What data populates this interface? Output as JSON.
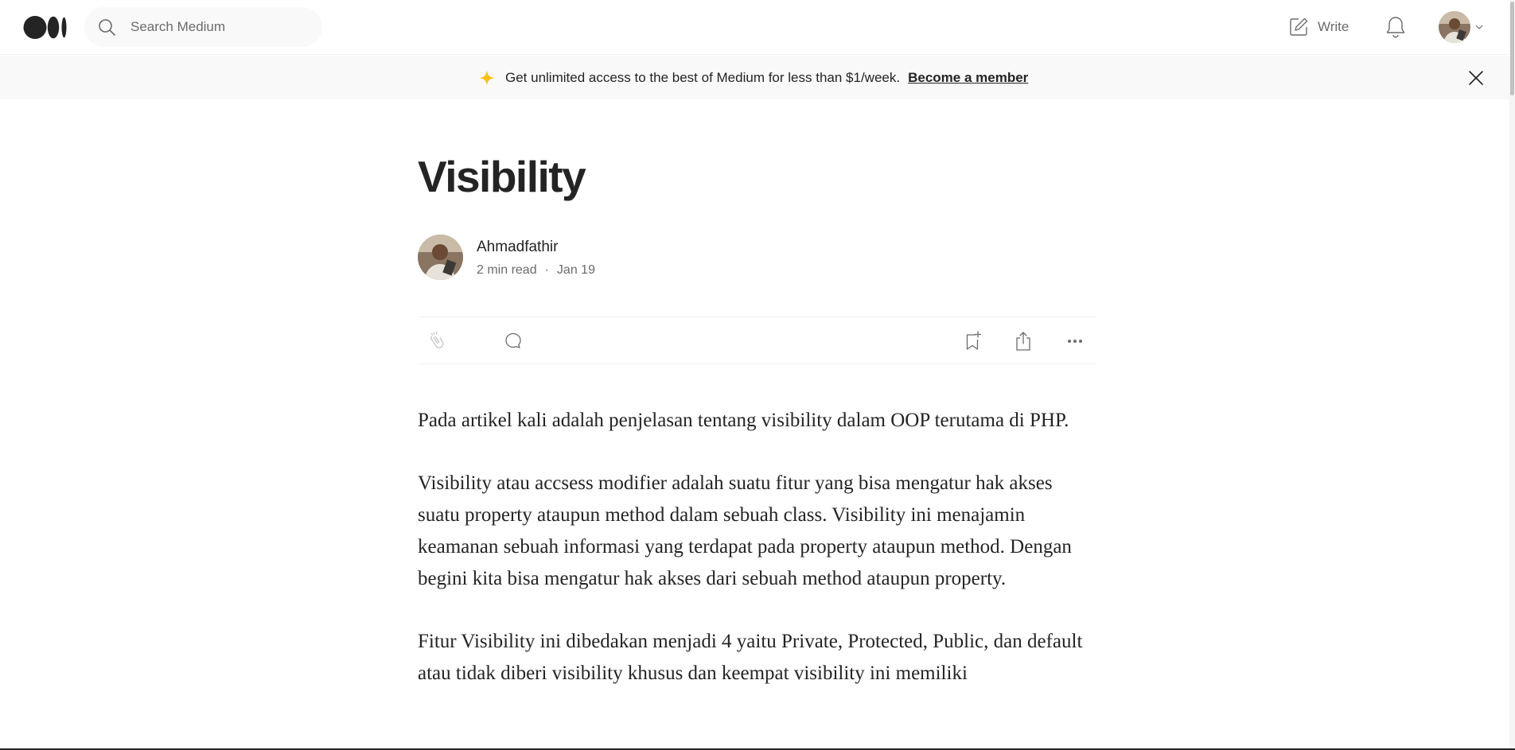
{
  "nav": {
    "logo_name": "medium-logo",
    "search_placeholder": "Search Medium",
    "write_label": "Write"
  },
  "banner": {
    "message": "Get unlimited access to the best of Medium for less than $1/week.",
    "link_label": "Become a member"
  },
  "article": {
    "title": "Visibility",
    "author": "Ahmadfathir",
    "read_time": "2 min read",
    "separator": "·",
    "date": "Jan 19",
    "paragraphs": [
      "Pada artikel kali adalah penjelasan tentang visibility dalam OOP terutama di PHP.",
      "Visibility atau accsess modifier adalah suatu fitur yang bisa mengatur hak akses suatu property ataupun method dalam sebuah class. Visibility ini menajamin keamanan sebuah informasi yang terdapat pada property ataupun method. Dengan begini kita bisa mengatur hak akses dari sebuah method ataupun property.",
      "Fitur Visibility ini dibedakan menjadi 4 yaitu Private, Protected, Public, dan default atau tidak diberi visibility khusus dan keempat visibility ini memiliki"
    ]
  },
  "colors": {
    "text": "#242424",
    "muted": "#6b6b6b",
    "banner_bg": "#f9f9f9",
    "sparkle": "#ffc017"
  }
}
